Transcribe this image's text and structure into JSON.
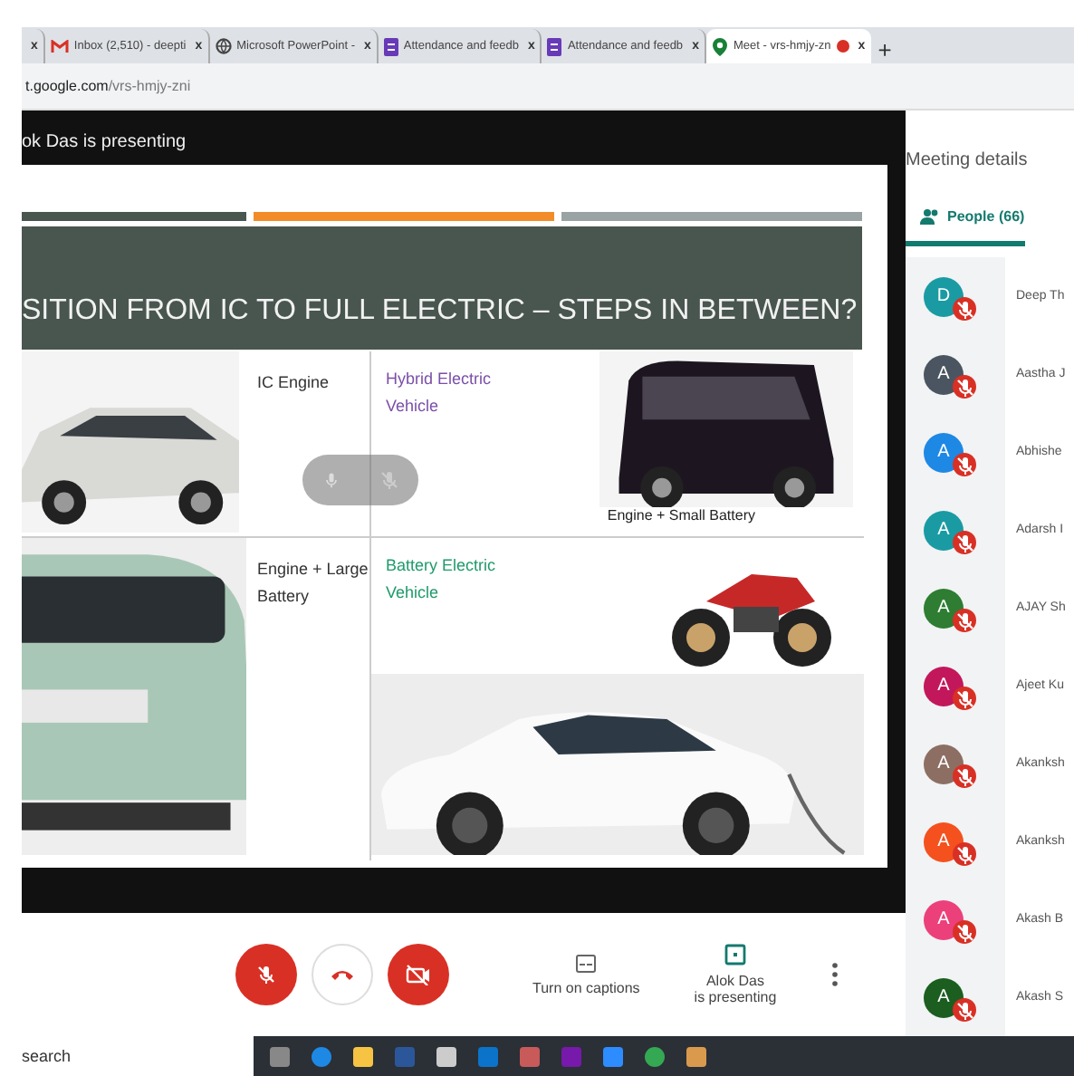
{
  "tabs": [
    {
      "kind": "partial",
      "selected": false,
      "close": "x"
    },
    {
      "kind": "mail",
      "title": "Inbox (2,510) - deepti",
      "selected": false,
      "close": "x"
    },
    {
      "kind": "globe",
      "title": "Microsoft PowerPoint -",
      "selected": false,
      "close": "x"
    },
    {
      "kind": "form",
      "title": "Attendance and feedb",
      "selected": false,
      "close": "x"
    },
    {
      "kind": "form",
      "title": "Attendance and feedb",
      "selected": false,
      "close": "x"
    },
    {
      "kind": "meet",
      "title": "Meet - vrs-hmjy-zn",
      "selected": true,
      "recording": true,
      "close": "x"
    }
  ],
  "new_tab": "+",
  "address": {
    "host": "t.google.com",
    "path": "/vrs-hmjy-zni"
  },
  "presenter_label": "ok Das is presenting",
  "slide": {
    "title": "SITION FROM IC TO FULL ELECTRIC – STEPS IN BETWEEN?",
    "quadrants": [
      {
        "label": "IC Engine",
        "color": "#333333"
      },
      {
        "label": "Hybrid Electric Vehicle",
        "color": "#7b4fa8",
        "note": "Engine + Small Battery"
      },
      {
        "label": "Engine + Large Battery",
        "color": "#333333"
      },
      {
        "label": "Battery Electric Vehicle",
        "color": "#1f9a6a"
      }
    ]
  },
  "meeting": {
    "title": "Meeting details",
    "people_tab": {
      "label": "People (66)",
      "selected": true
    },
    "people": [
      {
        "initial": "D",
        "name": "Deep Th",
        "color": "#1a9ba3",
        "muted": true
      },
      {
        "initial": "A",
        "name": "Aastha J",
        "color": "#4a5561",
        "muted": true
      },
      {
        "initial": "A",
        "name": "Abhishe",
        "color": "#1e88e5",
        "muted": true
      },
      {
        "initial": "A",
        "name": "Adarsh I",
        "color": "#1a9ba3",
        "muted": true
      },
      {
        "initial": "A",
        "name": "AJAY Sh",
        "color": "#2e7d32",
        "muted": true
      },
      {
        "initial": "A",
        "name": "Ajeet Ku",
        "color": "#c2185b",
        "muted": true
      },
      {
        "initial": "A",
        "name": "Akanksh",
        "color": "#8d6e63",
        "muted": true
      },
      {
        "initial": "A",
        "name": "Akanksh",
        "color": "#f4511e",
        "muted": true
      },
      {
        "initial": "A",
        "name": "Akash B",
        "color": "#ec407a",
        "muted": true
      },
      {
        "initial": "A",
        "name": "Akash S",
        "color": "#1b5e20",
        "muted": true
      }
    ]
  },
  "controls": {
    "mic_on": false,
    "camera_on": false,
    "captions": "Turn on captions",
    "presenting": "Alok Das\nis presenting"
  },
  "taskbar": {
    "search": "search"
  }
}
